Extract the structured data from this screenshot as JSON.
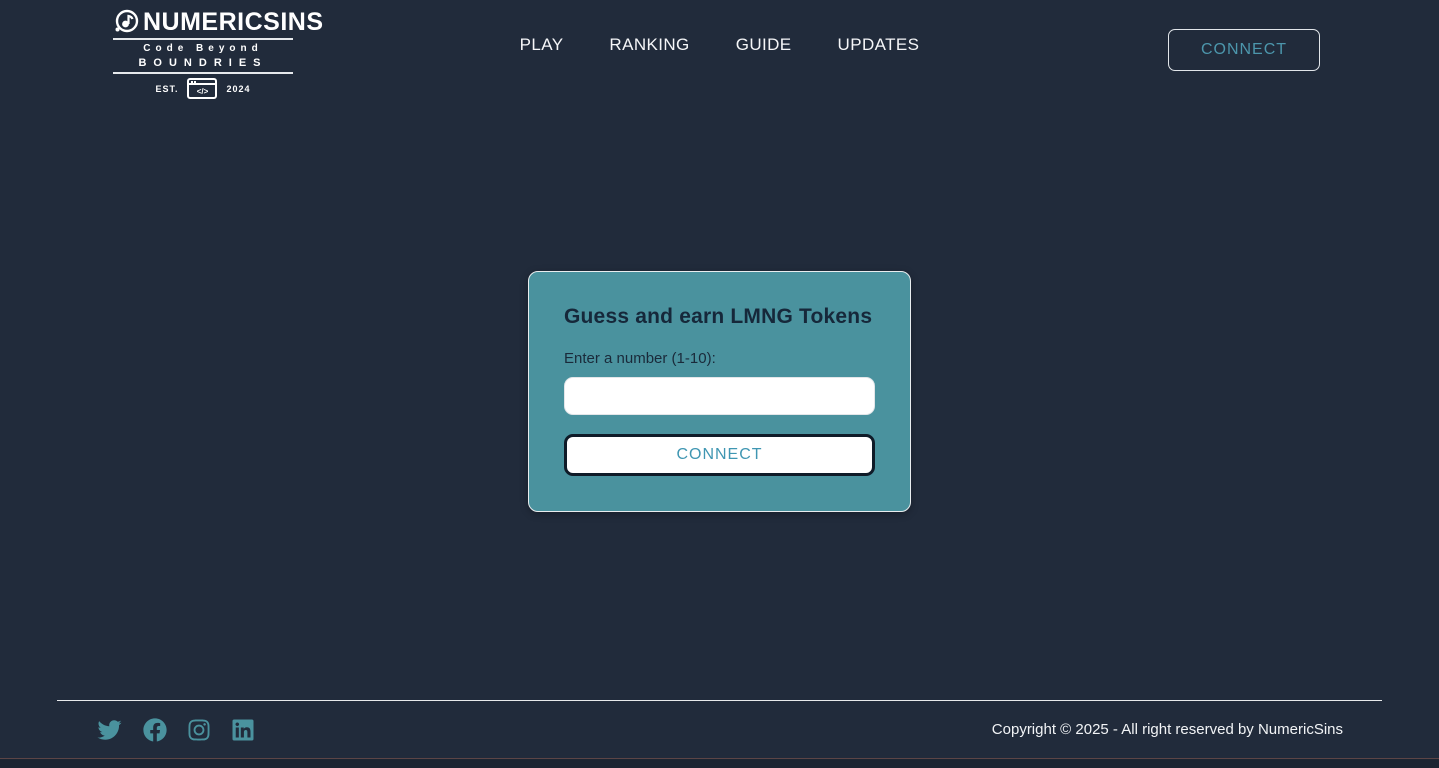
{
  "colors": {
    "bg": "#212B3B",
    "card": "#4A929E",
    "accent": "#4C96AC",
    "accent-dark": "#3F96B2",
    "dark-border": "#0F1B28",
    "text-light": "#F2F4F6",
    "ink": "#16283A"
  },
  "header": {
    "logo": {
      "name": "NUMERICSINS",
      "tagline_line1": "Code Beyond",
      "tagline_line2": "BOUNDRIES",
      "est_label": "EST.",
      "est_year": "2024",
      "code_glyph": "</>"
    },
    "nav": [
      {
        "label": "PLAY"
      },
      {
        "label": "RANKING"
      },
      {
        "label": "GUIDE"
      },
      {
        "label": "UPDATES"
      }
    ],
    "connect_label": "CONNECT"
  },
  "main": {
    "card": {
      "title": "Guess and earn LMNG Tokens",
      "input_label": "Enter a number (1-10):",
      "input_value": "",
      "button_label": "CONNECT"
    }
  },
  "footer": {
    "social": [
      "twitter",
      "facebook",
      "instagram",
      "linkedin"
    ],
    "copyright": "Copyright © 2025 - All right reserved by NumericSins"
  }
}
